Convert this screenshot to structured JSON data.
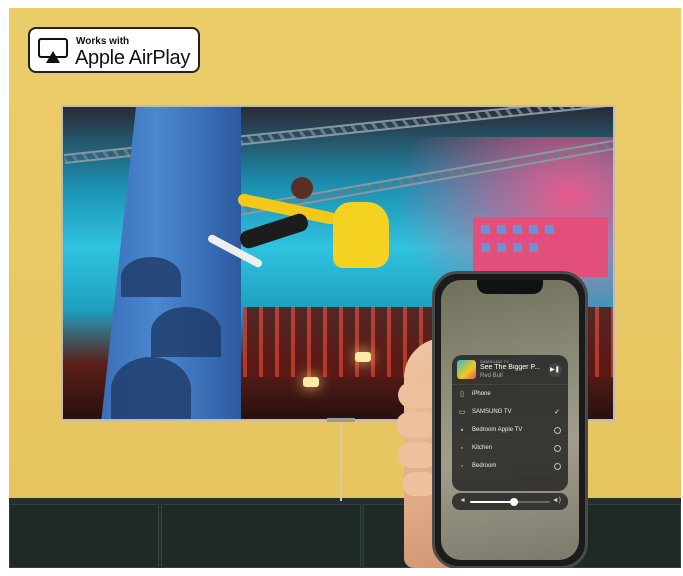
{
  "badge": {
    "small": "Works with",
    "big": "Apple AirPlay"
  },
  "now_playing": {
    "device": "SAMSUNG TV",
    "title": "See The Bigger P...",
    "artist": "Red Bull",
    "control_icon": "play-pause-icon"
  },
  "devices": [
    {
      "label": "iPhone",
      "icon": "phone-icon",
      "state": "none"
    },
    {
      "label": "SAMSUNG TV",
      "icon": "tv-icon",
      "state": "selected"
    },
    {
      "label": "Bedroom Apple TV",
      "icon": "appletv-icon",
      "state": "radio"
    },
    {
      "label": "Kitchen",
      "icon": "speaker-icon",
      "state": "radio"
    },
    {
      "label": "Bedroom",
      "icon": "speaker-icon",
      "state": "radio"
    }
  ],
  "volume": {
    "level": 0.55
  },
  "colors": {
    "wall": "#e8c865",
    "cabinet": "#23302e",
    "panel": "#1c1c1c"
  }
}
